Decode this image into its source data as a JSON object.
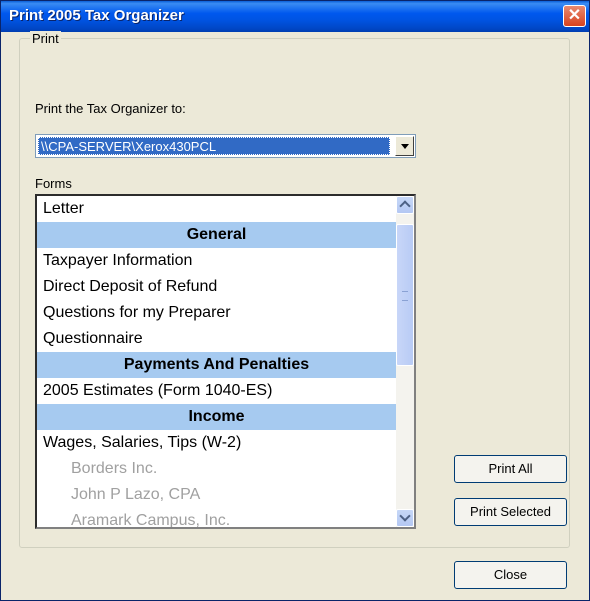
{
  "window": {
    "title": "Print 2005 Tax Organizer",
    "close_glyph": "✕"
  },
  "group": {
    "label": "Print"
  },
  "printer": {
    "label": "Print the Tax Organizer to:",
    "selected": "\\\\CPA-SERVER\\Xerox430PCL"
  },
  "forms": {
    "label": "Forms",
    "items": [
      {
        "text": "Letter",
        "kind": "item"
      },
      {
        "text": "General",
        "kind": "header"
      },
      {
        "text": "Taxpayer Information",
        "kind": "item"
      },
      {
        "text": "Direct Deposit of Refund",
        "kind": "item"
      },
      {
        "text": "Questions for my Preparer",
        "kind": "item"
      },
      {
        "text": "Questionnaire",
        "kind": "item"
      },
      {
        "text": "Payments And Penalties",
        "kind": "header"
      },
      {
        "text": "2005 Estimates (Form 1040-ES)",
        "kind": "item"
      },
      {
        "text": "Income",
        "kind": "header"
      },
      {
        "text": "Wages, Salaries, Tips (W-2)",
        "kind": "item"
      },
      {
        "text": "Borders Inc.",
        "kind": "sub"
      },
      {
        "text": "John P Lazo, CPA",
        "kind": "sub"
      },
      {
        "text": "Aramark Campus, Inc.",
        "kind": "sub"
      }
    ]
  },
  "buttons": {
    "print_all": "Print All",
    "print_selected": "Print Selected",
    "close": "Close"
  },
  "icons": {
    "dropdown": "chevron-down-icon",
    "scroll_up": "arrow-up-icon",
    "scroll_down": "arrow-down-icon"
  }
}
